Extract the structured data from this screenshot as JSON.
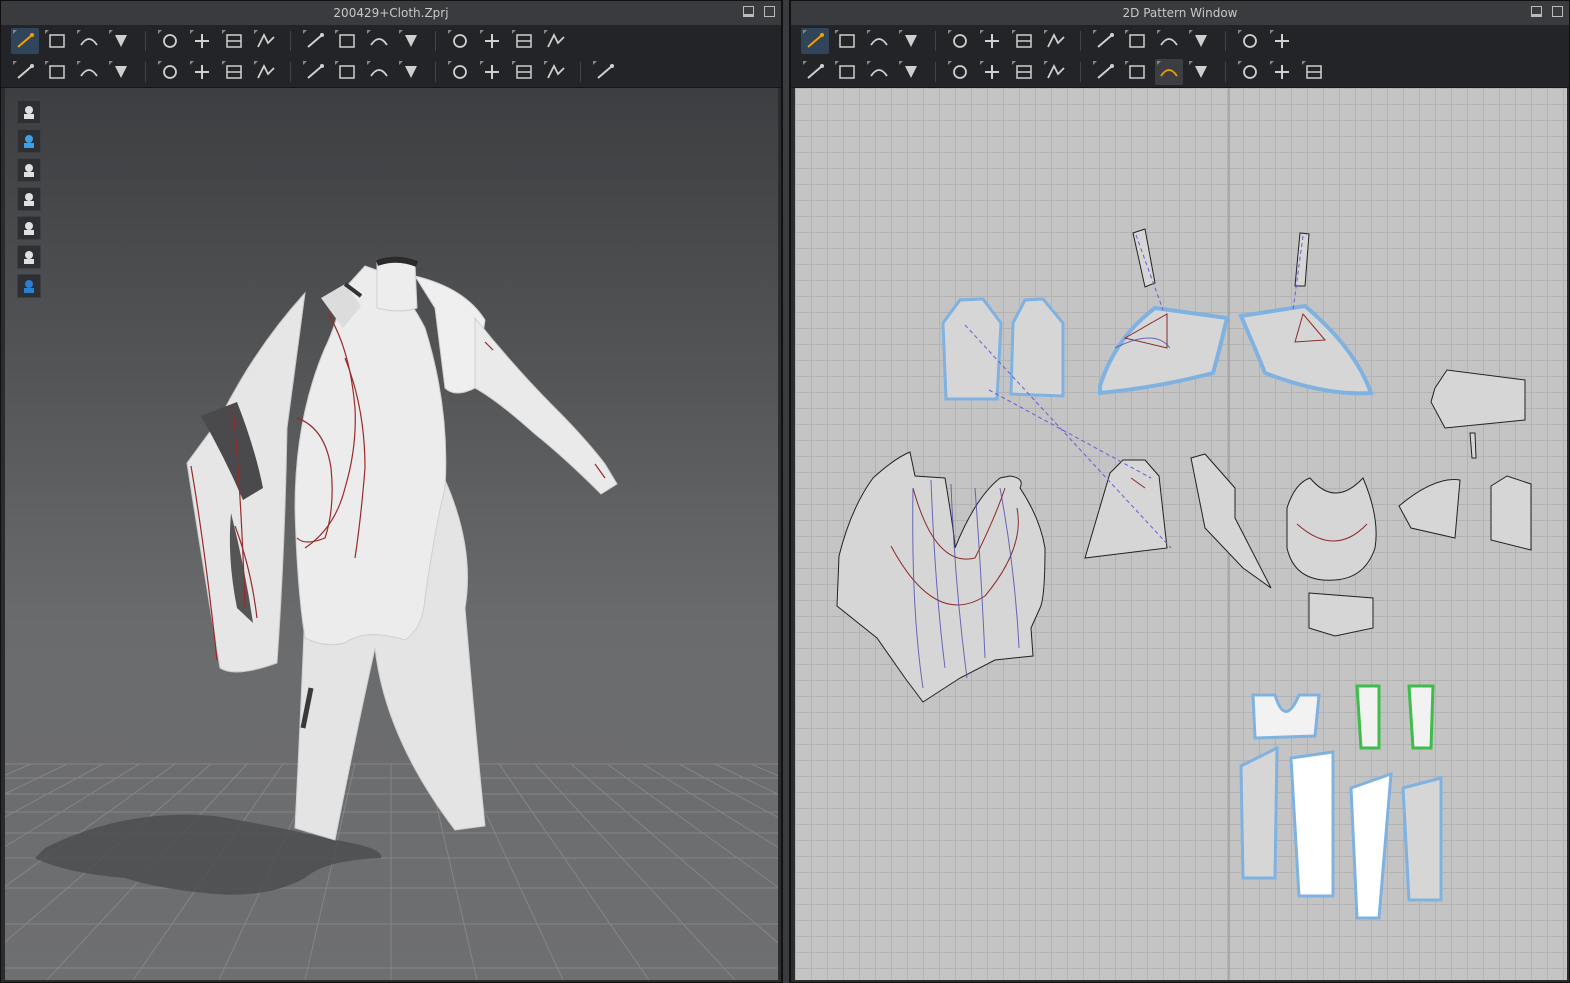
{
  "window_3d": {
    "title": "200429+Cloth.Zprj",
    "toolbar1": [
      "select-move-icon",
      "select-mesh-icon",
      "transform-pattern-icon",
      "fold-icon",
      "tack-icon",
      "tack-surface-icon",
      "tack-arrange-icon",
      "pin-icon",
      "fold-arrange-icon",
      "garment-icon",
      "edit-curvature-icon",
      "arrangement-icon",
      "steam-icon",
      "pleat-icon",
      "show-mesh-icon",
      "grid-icon"
    ],
    "toolbar2": [
      "simulate-icon",
      "sewing-icon",
      "sewing-free-icon",
      "brush-icon",
      "pressing-icon",
      "measure-icon",
      "texture-icon",
      "gradient-icon",
      "uv-icon",
      "button-icon",
      "buttonhole-icon",
      "line-icon",
      "zipper-icon",
      "zipper-puller-icon",
      "tape-icon",
      "ruler-icon",
      "move-icon"
    ],
    "side_buttons": [
      "garment-view-icon",
      "particles-icon",
      "avatar-icon",
      "texture-view-icon",
      "sewing-lines-icon",
      "avatar-silhouette-icon",
      "environment-icon"
    ]
  },
  "window_2d": {
    "title": "2D Pattern Window",
    "toolbar1": [
      "edit-pattern-icon",
      "edit-point-icon",
      "edit-curve-point-icon",
      "curve-icon",
      "segment-icon",
      "add-point-icon",
      "pattern-icon",
      "rectangle-icon",
      "polygon-icon",
      "internal-shape-icon",
      "trace-icon",
      "unfold-icon",
      "grid-toggle-icon",
      "arrange-grid-icon"
    ],
    "toolbar2": [
      "transform-icon",
      "transform-arrange-icon",
      "fold-2d-icon",
      "tack-2d-icon",
      "tack-surface-2d-icon",
      "iron-icon",
      "shirt-icon",
      "sew-2d-icon",
      "seam-free-icon",
      "seam-arrange-icon",
      "gizmo-icon",
      "line-2d-icon",
      "dashed-line-icon",
      "wave-line-icon",
      "dotted-line-icon"
    ],
    "active_tool_index_2d": 0,
    "highlight_tool_index_2d_row2": 10
  },
  "colors": {
    "accent": "#f0a000",
    "pattern_fill": "#d6d6d6",
    "pattern_selected": "#7fb2e0",
    "seam": "#8b2b2b",
    "internal": "#4b4bb0"
  }
}
